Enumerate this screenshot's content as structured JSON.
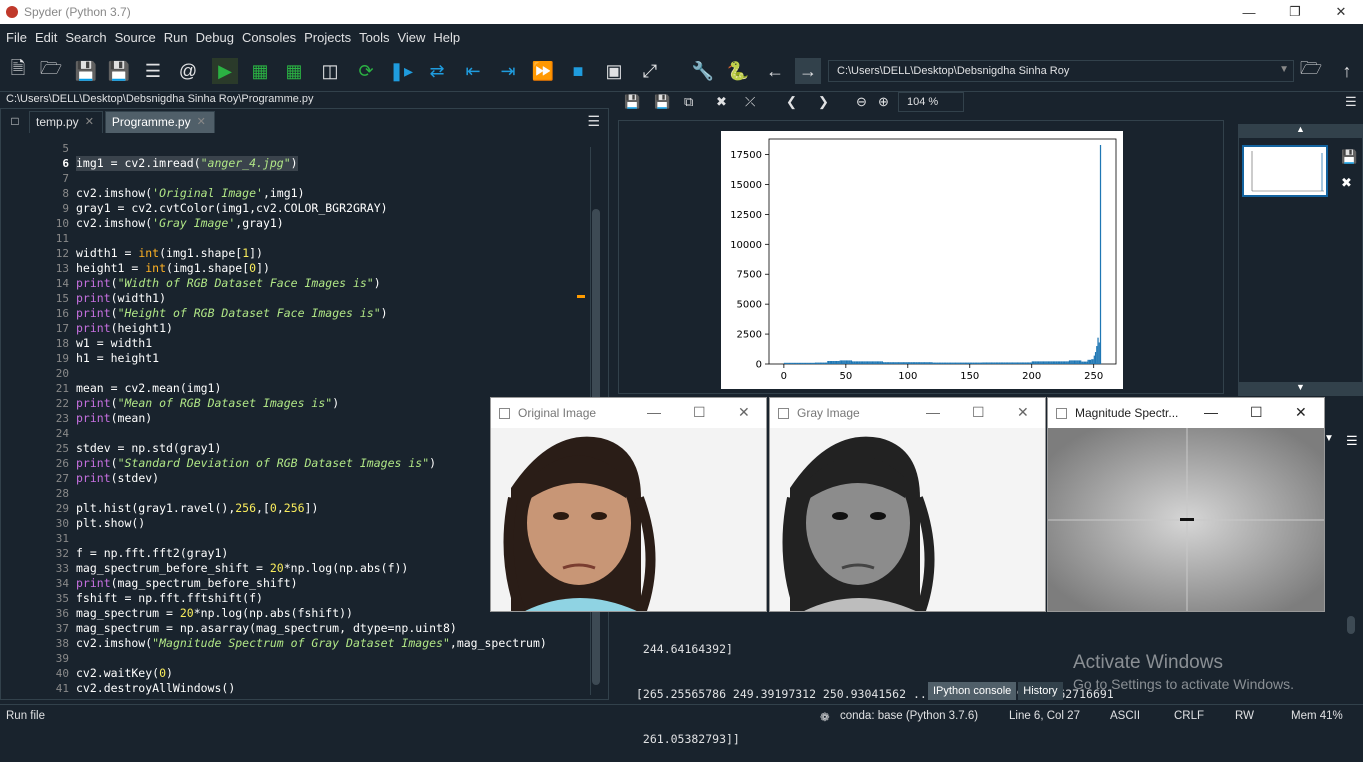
{
  "window": {
    "title": "Spyder (Python 3.7)"
  },
  "menu": [
    "File",
    "Edit",
    "Search",
    "Source",
    "Run",
    "Debug",
    "Consoles",
    "Projects",
    "Tools",
    "View",
    "Help"
  ],
  "toolbar": {
    "path": "C:\\Users\\DELL\\Desktop\\Debsnigdha Sinha Roy"
  },
  "editor": {
    "filepath": "C:\\Users\\DELL\\Desktop\\Debsnigdha Sinha Roy\\Programme.py",
    "tabs": [
      {
        "label": "temp.py"
      },
      {
        "label": "Programme.py"
      }
    ],
    "lines": [
      {
        "n": "5",
        "t": ""
      },
      {
        "n": "6",
        "t": "img1 = cv2.imread(\"anger_4.jpg\")"
      },
      {
        "n": "7",
        "t": ""
      },
      {
        "n": "8",
        "t": "cv2.imshow('Original Image',img1)"
      },
      {
        "n": "9",
        "t": "gray1 = cv2.cvtColor(img1,cv2.COLOR_BGR2GRAY)"
      },
      {
        "n": "10",
        "t": "cv2.imshow('Gray Image',gray1)"
      },
      {
        "n": "11",
        "t": ""
      },
      {
        "n": "12",
        "t": "width1 = int(img1.shape[1])"
      },
      {
        "n": "13",
        "t": "height1 = int(img1.shape[0])"
      },
      {
        "n": "14",
        "t": "print(\"Width of RGB Dataset Face Images is\")"
      },
      {
        "n": "15",
        "t": "print(width1)"
      },
      {
        "n": "16",
        "t": "print(\"Height of RGB Dataset Face Images is\")"
      },
      {
        "n": "17",
        "t": "print(height1)"
      },
      {
        "n": "18",
        "t": "w1 = width1"
      },
      {
        "n": "19",
        "t": "h1 = height1"
      },
      {
        "n": "20",
        "t": ""
      },
      {
        "n": "21",
        "t": "mean = cv2.mean(img1)"
      },
      {
        "n": "22",
        "t": "print(\"Mean of RGB Dataset Images is\")"
      },
      {
        "n": "23",
        "t": "print(mean)"
      },
      {
        "n": "24",
        "t": ""
      },
      {
        "n": "25",
        "t": "stdev = np.std(gray1)"
      },
      {
        "n": "26",
        "t": "print(\"Standard Deviation of RGB Dataset Images is\")"
      },
      {
        "n": "27",
        "t": "print(stdev)"
      },
      {
        "n": "28",
        "t": ""
      },
      {
        "n": "29",
        "t": "plt.hist(gray1.ravel(),256,[0,256])"
      },
      {
        "n": "30",
        "t": "plt.show()"
      },
      {
        "n": "31",
        "t": ""
      },
      {
        "n": "32",
        "t": "f = np.fft.fft2(gray1)"
      },
      {
        "n": "33",
        "t": "mag_spectrum_before_shift = 20*np.log(np.abs(f))"
      },
      {
        "n": "34",
        "t": "print(mag_spectrum_before_shift)"
      },
      {
        "n": "35",
        "t": "fshift = np.fft.fftshift(f)"
      },
      {
        "n": "36",
        "t": "mag_spectrum = 20*np.log(np.abs(fshift))"
      },
      {
        "n": "37",
        "t": "mag_spectrum = np.asarray(mag_spectrum, dtype=np.uint8)"
      },
      {
        "n": "38",
        "t": "cv2.imshow(\"Magnitude Spectrum of Gray Dataset Images\",mag_spectrum)"
      },
      {
        "n": "39",
        "t": ""
      },
      {
        "n": "40",
        "t": "cv2.waitKey(0)"
      },
      {
        "n": "41",
        "t": "cv2.destroyAllWindows()"
      }
    ]
  },
  "plots": {
    "zoom": "104 %"
  },
  "chart_data": {
    "type": "bar",
    "title": "",
    "xlabel": "",
    "ylabel": "",
    "xlim": [
      -12,
      268
    ],
    "ylim": [
      0,
      18800
    ],
    "xticks": [
      "0",
      "50",
      "100",
      "150",
      "200",
      "250"
    ],
    "yticks": [
      "0",
      "2500",
      "5000",
      "7500",
      "10000",
      "12500",
      "15000",
      "17500"
    ],
    "color": "#1f77b4",
    "x": [
      0,
      25,
      35,
      45,
      55,
      80,
      120,
      160,
      200,
      230,
      240,
      245,
      248,
      250,
      251,
      252,
      253,
      254,
      255
    ],
    "values": [
      100,
      120,
      250,
      300,
      220,
      150,
      120,
      130,
      220,
      300,
      200,
      350,
      500,
      700,
      1000,
      1500,
      2200,
      1800,
      18300
    ]
  },
  "console": {
    "lines": [
      " 244.64164392]",
      "[265.25565786 249.39197312 250.93041562 ... 250.53964009 256.62716691",
      " 261.05382793]]"
    ],
    "tabs": [
      "IPython console",
      "History"
    ]
  },
  "cv_windows": [
    {
      "title": "Original Image"
    },
    {
      "title": "Gray Image"
    },
    {
      "title": "Magnitude Spectr..."
    }
  ],
  "watermark": {
    "line1": "Activate Windows",
    "line2": "Go to Settings to activate Windows."
  },
  "status": {
    "left": "Run file",
    "env": "conda: base (Python 3.7.6)",
    "position": "Line 6, Col 27",
    "encoding": "ASCII",
    "eol": "CRLF",
    "mode": "RW",
    "mem": "Mem 41%"
  }
}
